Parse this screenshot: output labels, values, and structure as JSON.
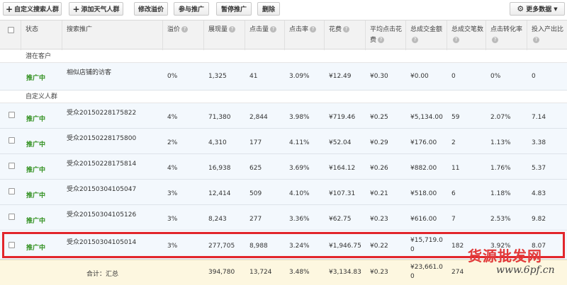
{
  "toolbar": {
    "add_custom": "自定义搜索人群",
    "add_weather": "添加天气人群",
    "modify_premium": "修改溢价",
    "join_promo": "参与推广",
    "pause_promo": "暂停推广",
    "delete": "删除",
    "more_data": "更多数据"
  },
  "columns": [
    "状态",
    "搜索推广",
    "溢价",
    "展现量",
    "点击量",
    "点击率",
    "花费",
    "平均点击花费",
    "总成交金额",
    "总成交笔数",
    "点击转化率",
    "投入产出比"
  ],
  "groups": {
    "potential": "潜在客户",
    "custom": "自定义人群"
  },
  "potential_rows": [
    {
      "status": "推广中",
      "name": "相似店铺的访客",
      "premium": "0%",
      "impressions": "1,325",
      "clicks": "41",
      "ctr": "3.09%",
      "cost": "¥12.49",
      "cpc": "¥0.30",
      "gmv": "¥0.00",
      "orders": "0",
      "cvr": "0%",
      "roi": "0"
    }
  ],
  "custom_rows": [
    {
      "status": "推广中",
      "name": "受众20150228175822",
      "premium": "4%",
      "impressions": "71,380",
      "clicks": "2,844",
      "ctr": "3.98%",
      "cost": "¥719.46",
      "cpc": "¥0.25",
      "gmv": "¥5,134.00",
      "orders": "59",
      "cvr": "2.07%",
      "roi": "7.14"
    },
    {
      "status": "推广中",
      "name": "受众20150228175800",
      "premium": "2%",
      "impressions": "4,310",
      "clicks": "177",
      "ctr": "4.11%",
      "cost": "¥52.04",
      "cpc": "¥0.29",
      "gmv": "¥176.00",
      "orders": "2",
      "cvr": "1.13%",
      "roi": "3.38"
    },
    {
      "status": "推广中",
      "name": "受众20150228175814",
      "premium": "4%",
      "impressions": "16,938",
      "clicks": "625",
      "ctr": "3.69%",
      "cost": "¥164.12",
      "cpc": "¥0.26",
      "gmv": "¥882.00",
      "orders": "11",
      "cvr": "1.76%",
      "roi": "5.37"
    },
    {
      "status": "推广中",
      "name": "受众20150304105047",
      "premium": "3%",
      "impressions": "12,414",
      "clicks": "509",
      "ctr": "4.10%",
      "cost": "¥107.31",
      "cpc": "¥0.21",
      "gmv": "¥518.00",
      "orders": "6",
      "cvr": "1.18%",
      "roi": "4.83"
    },
    {
      "status": "推广中",
      "name": "受众20150304105126",
      "premium": "3%",
      "impressions": "8,243",
      "clicks": "277",
      "ctr": "3.36%",
      "cost": "¥62.75",
      "cpc": "¥0.23",
      "gmv": "¥616.00",
      "orders": "7",
      "cvr": "2.53%",
      "roi": "9.82"
    },
    {
      "status": "推广中",
      "name": "受众20150304105014",
      "premium": "3%",
      "impressions": "277,705",
      "clicks": "8,988",
      "ctr": "3.24%",
      "cost": "¥1,946.75",
      "cpc": "¥0.22",
      "gmv_line1": "¥15,719.0",
      "gmv_line2": "0",
      "orders": "182",
      "cvr": "3.92%",
      "roi": "8.07"
    }
  ],
  "total": {
    "label": "合计：汇总",
    "impressions": "394,780",
    "clicks": "13,724",
    "ctr": "3.48%",
    "cost": "¥3,134.83",
    "cpc": "¥0.23",
    "gmv_line1": "¥23,661.0",
    "gmv_line2": "0",
    "orders": "274"
  },
  "watermark": {
    "cn": "货源批发网",
    "url": "www.6pf.cn"
  },
  "colors": {
    "status": "#2f8f1d",
    "highlight": "#e2262b",
    "row_bg": "#f3f8fd",
    "total_bg": "#fdf7e0"
  }
}
